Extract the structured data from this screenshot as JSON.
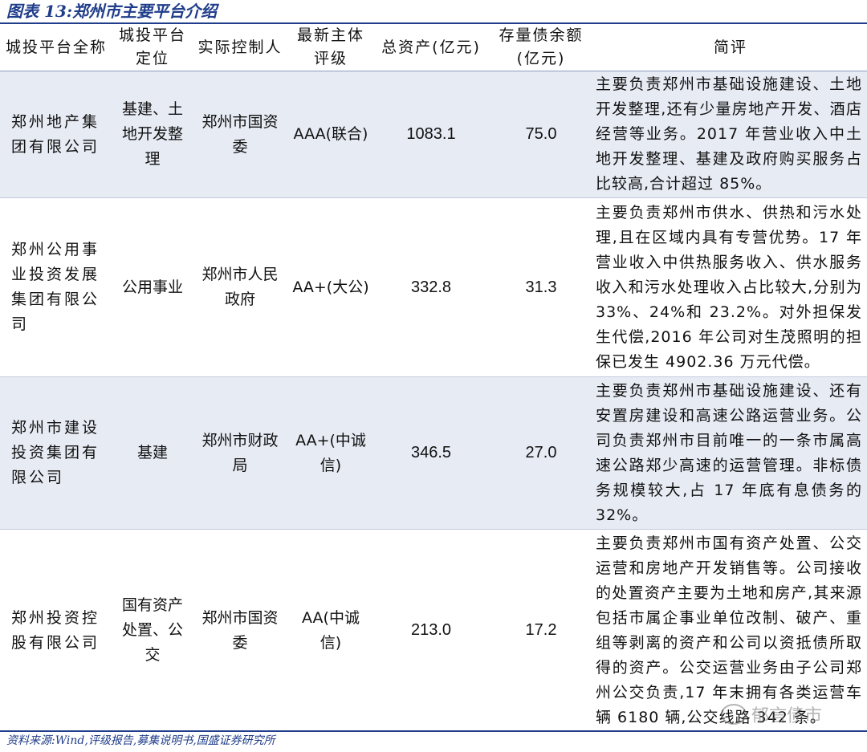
{
  "figure": {
    "title": "图表 13:郑州市主要平台介绍"
  },
  "table": {
    "headers": [
      "城投平台全称",
      "城投平台定位",
      "实际控制人",
      "最新主体评级",
      "总资产(亿元)",
      "存量债余额(亿元)",
      "简评"
    ],
    "rows": [
      {
        "name": "郑州地产集团有限公司",
        "position": "基建、土地开发整理",
        "controller": "郑州市国资委",
        "rating": "AAA(联合)",
        "assets": "1083.1",
        "debt": "75.0",
        "comment": "主要负责郑州市基础设施建设、土地开发整理,还有少量房地产开发、酒店经营等业务。2017 年营业收入中土地开发整理、基建及政府购买服务占比较高,合计超过 85%。"
      },
      {
        "name": "郑州公用事业投资发展集团有限公司",
        "position": "公用事业",
        "controller": "郑州市人民政府",
        "rating": "AA+(大公)",
        "assets": "332.8",
        "debt": "31.3",
        "comment": "主要负责郑州市供水、供热和污水处理,且在区域内具有专营优势。17 年营业收入中供热服务收入、供水服务收入和污水处理收入占比较大,分别为 33%、24%和 23.2%。对外担保发生代偿,2016 年公司对生茂照明的担保已发生 4902.36 万元代偿。"
      },
      {
        "name": "郑州市建设投资集团有限公司",
        "position": "基建",
        "controller": "郑州市财政局",
        "rating": "AA+(中诚信)",
        "assets": "346.5",
        "debt": "27.0",
        "comment": "主要负责郑州市基础设施建设、还有安置房建设和高速公路运营业务。公司负责郑州市目前唯一的一条市属高速公路郑少高速的运营管理。非标债务规模较大,占 17 年底有息债务的 32%。"
      },
      {
        "name": "郑州投资控股有限公司",
        "position": "国有资产处置、公交",
        "controller": "郑州市国资委",
        "rating": "AA(中诚信)",
        "assets": "213.0",
        "debt": "17.2",
        "comment": "主要负责郑州市国有资产处置、公交运营和房地产开发销售等。公司接收的处置资产主要为土地和房产,其来源包括市属企事业单位改制、破产、重组等剥离的资产和公司以资抵债所取得的资产。公交运营业务由子公司郑州公交负责,17 年末拥有各类运营车辆 6180 辆,公交线路 342 条。"
      }
    ]
  },
  "source": "资料来源:Wind,评级报告,募集说明书,国盛证券研究所",
  "watermark": {
    "text": "郁言债市",
    "icon": "wechat-icon"
  }
}
